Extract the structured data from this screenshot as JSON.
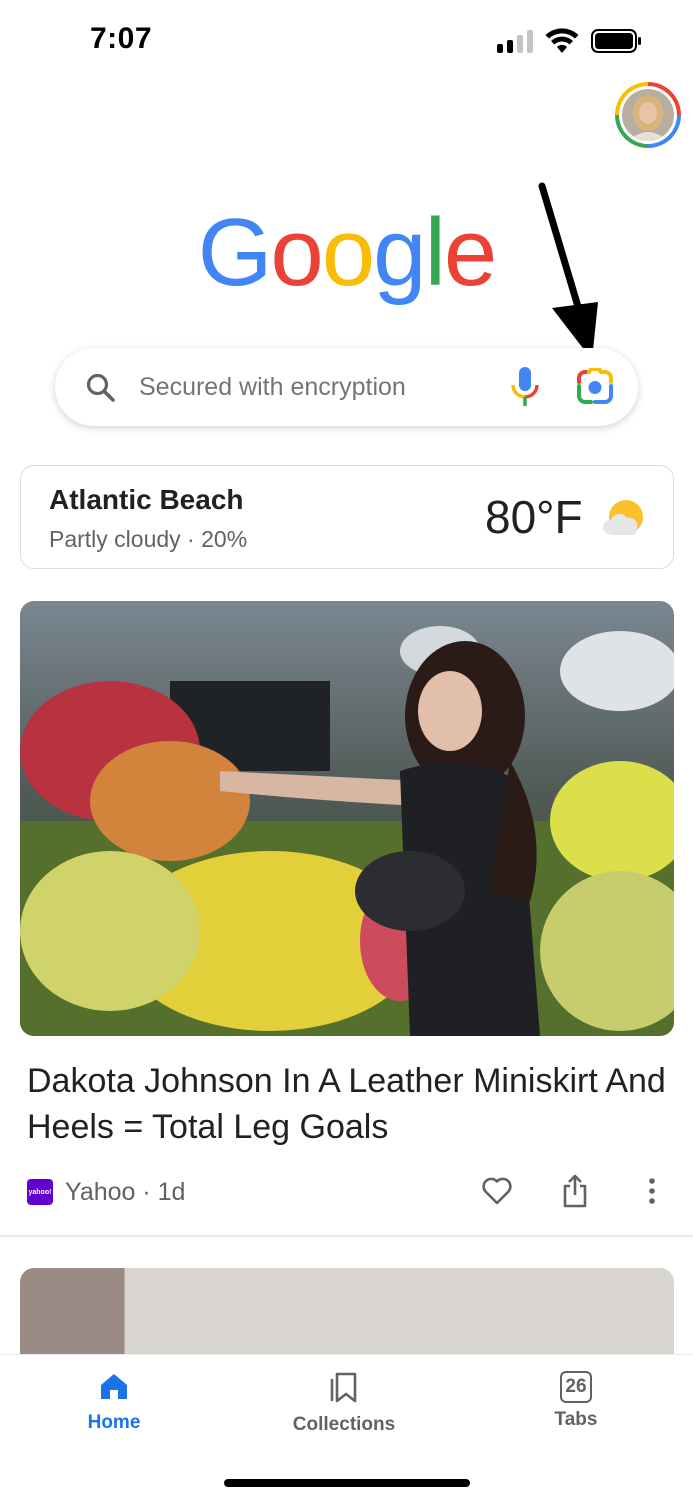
{
  "status_bar": {
    "time": "7:07"
  },
  "logo_text": "Google",
  "logo_colors": [
    "#4285F4",
    "#EA4335",
    "#FBBC05",
    "#4285F4",
    "#34A853",
    "#EA4335"
  ],
  "search": {
    "placeholder": "Secured with encryption"
  },
  "weather": {
    "city": "Atlantic Beach",
    "condition": "Partly cloudy · 20%",
    "temperature": "80°F",
    "icon": "partly-cloudy-icon"
  },
  "article": {
    "title": "Dakota Johnson In A Leather Miniskirt And Heels = Total Leg Goals",
    "source_logo_text": "yahoo!",
    "source": "Yahoo · 1d"
  },
  "bottom_nav": {
    "items": [
      {
        "label": "Home",
        "icon": "home-icon",
        "active": true
      },
      {
        "label": "Collections",
        "icon": "bookmark-icon",
        "active": false
      },
      {
        "label": "Tabs",
        "icon": "tabs-icon",
        "count": "26",
        "active": false
      }
    ]
  },
  "colors": {
    "accent": "#1a73e8",
    "yahoo": "#6001d2"
  }
}
